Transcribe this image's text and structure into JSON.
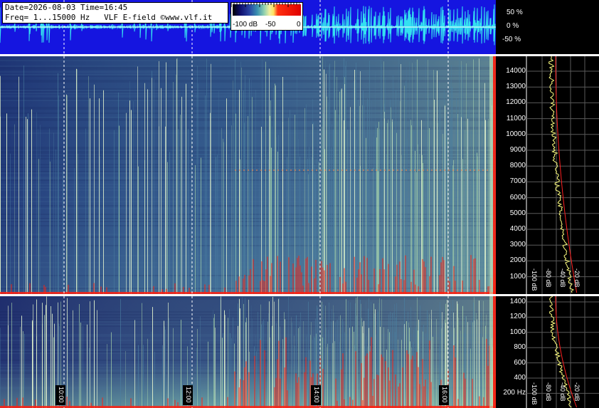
{
  "header": {
    "date_line": "Date=2026-08-03 Time=16:45",
    "freq_line": "Freq= 1...15000 Hz   VLF E-field ©www.vlf.it"
  },
  "colorbar": {
    "labels": [
      "-100 dB",
      "-50",
      "0"
    ],
    "colors": [
      "#000000",
      "#101070",
      "#2840a0",
      "#3a90b0",
      "#8fd0b0",
      "#f0f0a0",
      "#ffe060",
      "#ff3010",
      "#e00000"
    ]
  },
  "waveform": {
    "scale_labels": [
      "50 %",
      "0 %",
      "-50 %"
    ],
    "background_color": "#1515e0",
    "trace_color": "#33e0f0"
  },
  "spectrogram_top": {
    "freq_labels": [
      "14000",
      "13000",
      "12000",
      "11000",
      "10000",
      "9000",
      "8000",
      "7000",
      "6000",
      "5000",
      "4000",
      "3000",
      "2000",
      "1000"
    ],
    "db_labels": [
      "-100 dB",
      "-80 dB",
      "-40 dB",
      "-20 dB"
    ]
  },
  "spectrogram_bottom": {
    "freq_labels": [
      "1400",
      "1200",
      "1000",
      "800",
      "600",
      "400",
      "200 Hz"
    ],
    "db_labels": [
      "-100 dB",
      "-80 dB",
      "-40 dB",
      "-20 dB"
    ]
  },
  "time_labels": [
    "10:00",
    "12:00",
    "14:00",
    "16:00"
  ],
  "colors": {
    "noise_low": "#1a2a6e",
    "noise_mid": "#4a7fa0",
    "noise_high": "#b8e6b0",
    "sferic": "#ff2010",
    "spectrum_trace": "#ffff80",
    "spectrum_mean": "#ff2020"
  }
}
